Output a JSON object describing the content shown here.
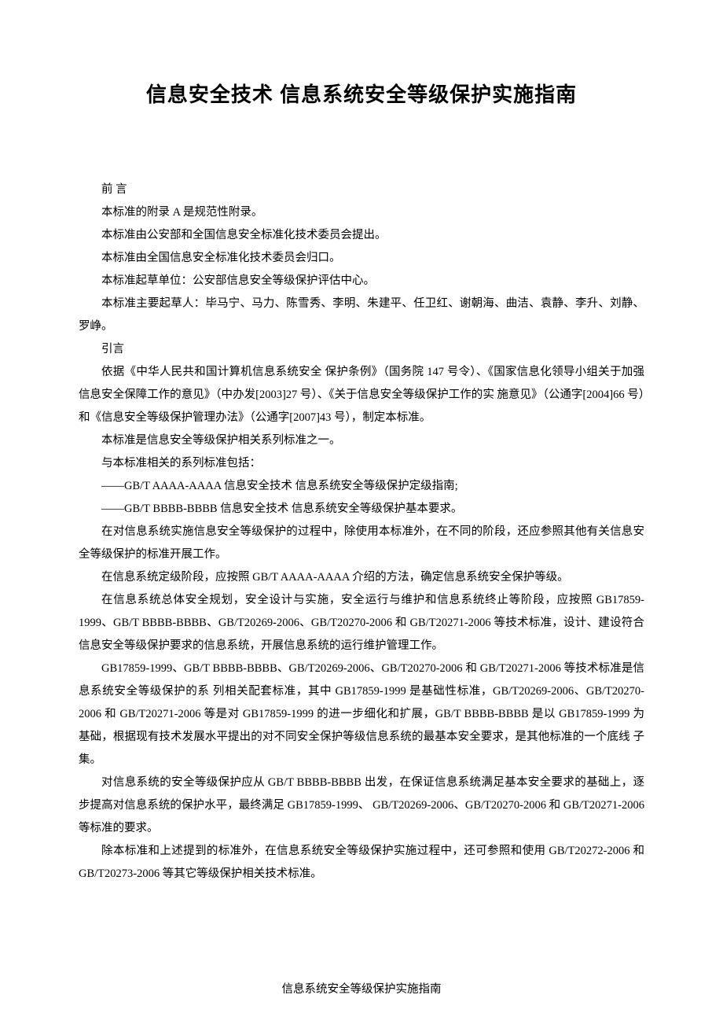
{
  "title": "信息安全技术 信息系统安全等级保护实施指南",
  "paragraphs": {
    "p1": "前 言",
    "p2": "本标准的附录 A 是规范性附录。",
    "p3": "本标准由公安部和全国信息安全标准化技术委员会提出。",
    "p4": "本标准由全国信息安全标准化技术委员会归口。",
    "p5": "本标准起草单位：公安部信息安全等级保护评估中心。",
    "p6": "本标准主要起草人：毕马宁、马力、陈雪秀、李明、朱建平、任卫红、谢朝海、曲洁、袁静、李升、刘静、罗峥。",
    "p7": "引言",
    "p8": "依据《中华人民共和国计算机信息系统安全 保护条例》（国务院 147 号令）、《国家信息化领导小组关于加强信息安全保障工作的意见》（中办发[2003]27 号）、《关于信息安全等级保护工作的实 施意见》（公通字[2004]66 号）和《信息安全等级保护管理办法》（公通字[2007]43 号），制定本标准。",
    "p9": "本标准是信息安全等级保护相关系列标准之一。",
    "p10": "与本标准相关的系列标准包括：",
    "p11": "——GB/T AAAA-AAAA 信息安全技术 信息系统安全等级保护定级指南;",
    "p12": "——GB/T BBBB-BBBB 信息安全技术 信息系统安全等级保护基本要求。",
    "p13": "在对信息系统实施信息安全等级保护的过程中，除使用本标准外，在不同的阶段，还应参照其他有关信息安全等级保护的标准开展工作。",
    "p14": "在信息系统定级阶段，应按照 GB/T AAAA-AAAA 介绍的方法，确定信息系统安全保护等级。",
    "p15": "在信息系统总体安全规划，安全设计与实施，安全运行与维护和信息系统终止等阶段，应按照 GB17859-1999、GB/T BBBB-BBBB、GB/T20269-2006、GB/T20270-2006 和 GB/T20271-2006 等技术标准，设计、建设符合信息安全等级保护要求的信息系统，开展信息系统的运行维护管理工作。",
    "p16": "GB17859-1999、GB/T BBBB-BBBB、GB/T20269-2006、GB/T20270-2006 和 GB/T20271-2006 等技术标准是信息系统安全等级保护的系 列相关配套标准，其中 GB17859-1999 是基础性标准，GB/T20269-2006、GB/T20270-2006 和 GB/T20271-2006 等是对 GB17859-1999 的进一步细化和扩展，GB/T BBBB-BBBB 是以 GB17859-1999 为基础，根据现有技术发展水平提出的对不同安全保护等级信息系统的最基本安全要求，是其他标准的一个底线 子集。",
    "p17": "对信息系统的安全等级保护应从 GB/T BBBB-BBBB 出发，在保证信息系统满足基本安全要求的基础上，逐步提高对信息系统的保护水平，最终满足 GB17859-1999、 GB/T20269-2006、GB/T20270-2006 和 GB/T20271-2006 等标准的要求。",
    "p18": "除本标准和上述提到的标准外，在信息系统安全等级保护实施过程中，还可参照和使用 GB/T20272-2006 和 GB/T20273-2006 等其它等级保护相关技术标准。"
  },
  "footer": "信息系统安全等级保护实施指南"
}
